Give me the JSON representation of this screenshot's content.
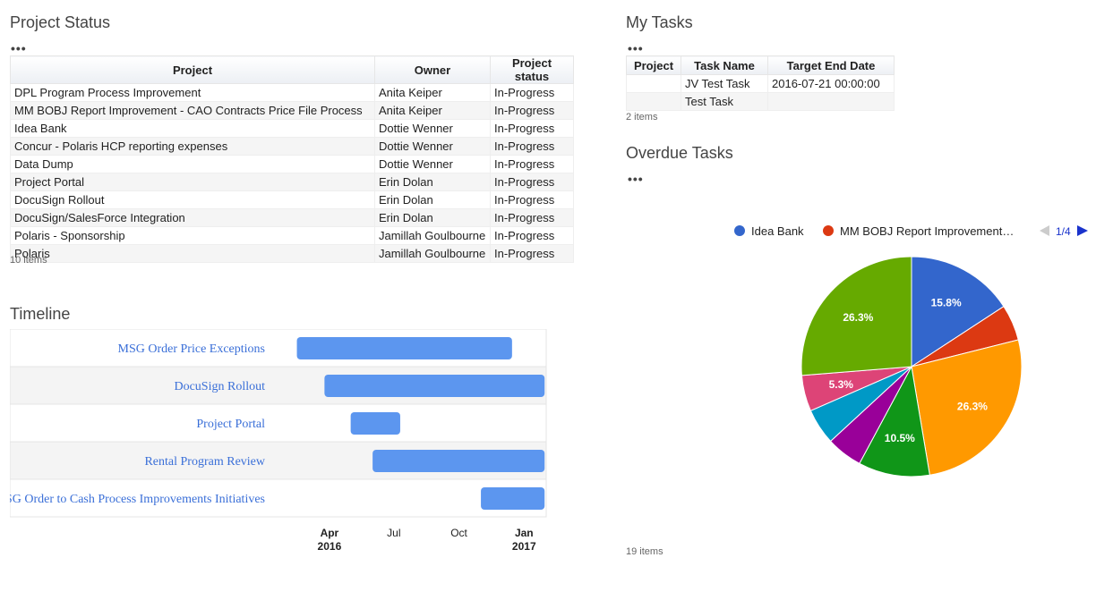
{
  "project_status": {
    "title": "Project Status",
    "menu": "•••",
    "columns": [
      "Project",
      "Owner",
      "Project status"
    ],
    "rows": [
      [
        "DPL Program Process Improvement",
        "Anita Keiper",
        "In-Progress"
      ],
      [
        "MM BOBJ Report Improvement - CAO Contracts Price File Process",
        "Anita Keiper",
        "In-Progress"
      ],
      [
        "Idea Bank",
        "Dottie Wenner",
        "In-Progress"
      ],
      [
        "Concur - Polaris HCP reporting expenses",
        "Dottie Wenner",
        "In-Progress"
      ],
      [
        "Data Dump",
        "Dottie Wenner",
        "In-Progress"
      ],
      [
        "Project Portal",
        "Erin Dolan",
        "In-Progress"
      ],
      [
        "DocuSign Rollout",
        "Erin Dolan",
        "In-Progress"
      ],
      [
        "DocuSign/SalesForce Integration",
        "Erin Dolan",
        "In-Progress"
      ],
      [
        "Polaris - Sponsorship",
        "Jamillah Goulbourne",
        "In-Progress"
      ],
      [
        "Polaris",
        "Jamillah Goulbourne",
        "In-Progress"
      ]
    ],
    "count": "10 items"
  },
  "my_tasks": {
    "title": "My Tasks",
    "menu": "•••",
    "columns": [
      "Project",
      "Task Name",
      "Target End Date"
    ],
    "rows": [
      [
        "",
        "JV Test Task",
        "2016-07-21 00:00:00"
      ],
      [
        "",
        "Test Task",
        ""
      ]
    ],
    "count": "2 items"
  },
  "timeline": {
    "title": "Timeline",
    "bar_color": "#5c96ef",
    "label_color": "#3a6fd8",
    "rows": [
      {
        "label": "MSG Order Price Exceptions",
        "start": "2016-02-15",
        "end": "2016-12-15"
      },
      {
        "label": "DocuSign Rollout",
        "start": "2016-03-25",
        "end": "2017-01-30"
      },
      {
        "label": "Project Portal",
        "start": "2016-05-01",
        "end": "2016-07-10"
      },
      {
        "label": "Rental Program Review",
        "start": "2016-06-01",
        "end": "2017-01-30"
      },
      {
        "label": "MSG Order to Cash Process Improvements Initiatives",
        "start": "2016-11-01",
        "end": "2017-01-30"
      }
    ],
    "axis_ticks": [
      {
        "label": "Apr",
        "sub": "2016",
        "date": "2016-04-01"
      },
      {
        "label": "Jul",
        "sub": "",
        "date": "2016-07-01"
      },
      {
        "label": "Oct",
        "sub": "",
        "date": "2016-10-01"
      },
      {
        "label": "Jan",
        "sub": "2017",
        "date": "2017-01-01"
      }
    ]
  },
  "overdue_tasks": {
    "title": "Overdue Tasks",
    "menu": "•••",
    "count": "19 items",
    "legend_page": "1/4",
    "legend": [
      {
        "label": "Idea Bank",
        "color": "#3366cc"
      },
      {
        "label": "MM BOBJ Report Improvement…",
        "color": "#dc3912"
      }
    ]
  },
  "chart_data": {
    "type": "pie",
    "slices": [
      {
        "name": "Idea Bank",
        "value": 15.8,
        "label": "15.8%",
        "color": "#3366cc"
      },
      {
        "name": "MM BOBJ Report Improvement…",
        "value": 5.3,
        "label": "",
        "color": "#dc3912"
      },
      {
        "name": "",
        "value": 26.3,
        "label": "26.3%",
        "color": "#ff9900"
      },
      {
        "name": "",
        "value": 10.5,
        "label": "10.5%",
        "color": "#109618"
      },
      {
        "name": "",
        "value": 5.3,
        "label": "",
        "color": "#990099"
      },
      {
        "name": "",
        "value": 5.3,
        "label": "",
        "color": "#0099c6"
      },
      {
        "name": "",
        "value": 5.3,
        "label": "5.3%",
        "color": "#dd4477"
      },
      {
        "name": "",
        "value": 26.3,
        "label": "26.3%",
        "color": "#66aa00"
      }
    ]
  }
}
